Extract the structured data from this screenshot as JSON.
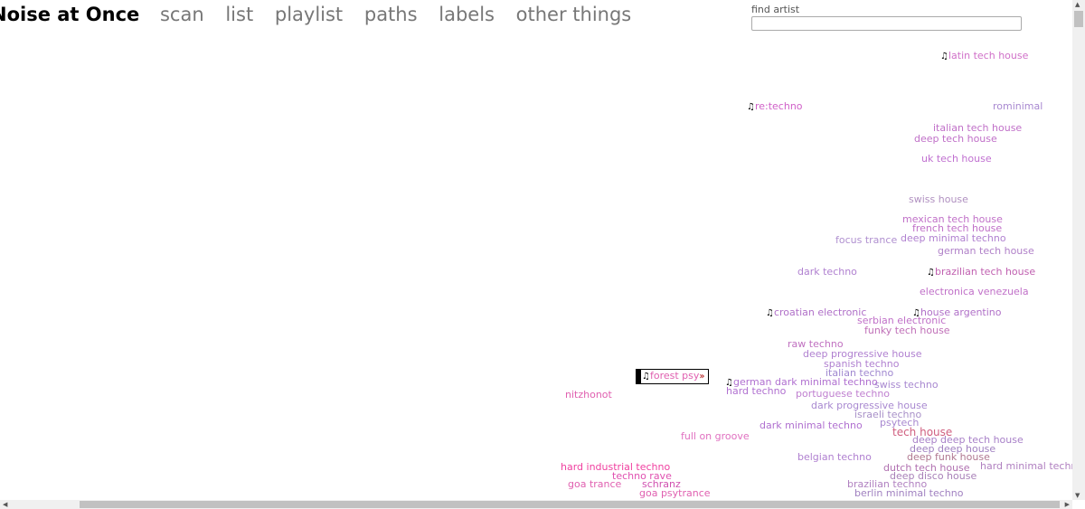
{
  "nav": {
    "title": "Noise at Once",
    "links": [
      "scan",
      "list",
      "playlist",
      "paths",
      "labels",
      "other things"
    ]
  },
  "search": {
    "label": "find artist",
    "value": "",
    "placeholder": ""
  },
  "note_icon": "♫",
  "genres": [
    {
      "name": "latin tech house",
      "color": "#d070c8",
      "play": true
    },
    {
      "name": "re:techno",
      "color": "#d060c8",
      "play": true
    },
    {
      "name": "rominimal",
      "color": "#a888d0"
    },
    {
      "name": "italian tech house",
      "color": "#c070c8"
    },
    {
      "name": "deep tech house",
      "color": "#c070c8"
    },
    {
      "name": "uk tech house",
      "color": "#c070d0"
    },
    {
      "name": "swiss house",
      "color": "#b090c0"
    },
    {
      "name": "mexican tech house",
      "color": "#c070c8"
    },
    {
      "name": "french tech house",
      "color": "#c070c8"
    },
    {
      "name": "focus trance",
      "color": "#b090d0"
    },
    {
      "name": "deep minimal techno",
      "color": "#b080d0"
    },
    {
      "name": "german tech house",
      "color": "#b080c8"
    },
    {
      "name": "dark techno",
      "color": "#b080d0"
    },
    {
      "name": "brazilian tech house",
      "color": "#c060b0",
      "play": true
    },
    {
      "name": "electronica venezuela",
      "color": "#c070c8"
    },
    {
      "name": "croatian electronic",
      "color": "#b070c8",
      "play": true
    },
    {
      "name": "house argentino",
      "color": "#b070c8",
      "play": true
    },
    {
      "name": "serbian electronic",
      "color": "#c070c8"
    },
    {
      "name": "funky tech house",
      "color": "#c070b8"
    },
    {
      "name": "raw techno",
      "color": "#c070c0"
    },
    {
      "name": "deep progressive house",
      "color": "#b080d0"
    },
    {
      "name": "spanish techno",
      "color": "#b080d0"
    },
    {
      "name": "italian techno",
      "color": "#a088d0"
    },
    {
      "name": "forest psy",
      "color": "#e060b0",
      "play": true,
      "selected": true,
      "more": "»"
    },
    {
      "name": "german dark minimal techno",
      "color": "#b070d0",
      "play": true
    },
    {
      "name": "hard techno",
      "color": "#b070d0"
    },
    {
      "name": "swiss techno",
      "color": "#a888d0"
    },
    {
      "name": "nitzhonot",
      "color": "#e060b0"
    },
    {
      "name": "portuguese techno",
      "color": "#c080d0"
    },
    {
      "name": "dark progressive house",
      "color": "#a888d0"
    },
    {
      "name": "israeli techno",
      "color": "#a890c8"
    },
    {
      "name": "psytech",
      "color": "#a888d0"
    },
    {
      "name": "dark minimal techno",
      "color": "#b070d0"
    },
    {
      "name": "tech house",
      "color": "#d06080"
    },
    {
      "name": "full on groove",
      "color": "#e070c0"
    },
    {
      "name": "deep deep tech house",
      "color": "#a880c8"
    },
    {
      "name": "deep deep house",
      "color": "#a080c0"
    },
    {
      "name": "deep funk house",
      "color": "#b07890"
    },
    {
      "name": "belgian techno",
      "color": "#b080d0"
    },
    {
      "name": "hard industrial techno",
      "color": "#f040a0"
    },
    {
      "name": "hard minimal techno",
      "color": "#b080c0"
    },
    {
      "name": "dutch tech house",
      "color": "#b070b0"
    },
    {
      "name": "techno rave",
      "color": "#e050b0"
    },
    {
      "name": "deep disco house",
      "color": "#a880b8"
    },
    {
      "name": "goa trance",
      "color": "#e060b0"
    },
    {
      "name": "schranz",
      "color": "#d050b0"
    },
    {
      "name": "brazilian techno",
      "color": "#b080c0"
    },
    {
      "name": "goa psytrance",
      "color": "#e060b0"
    },
    {
      "name": "berlin minimal techno",
      "color": "#a080c0"
    }
  ]
}
